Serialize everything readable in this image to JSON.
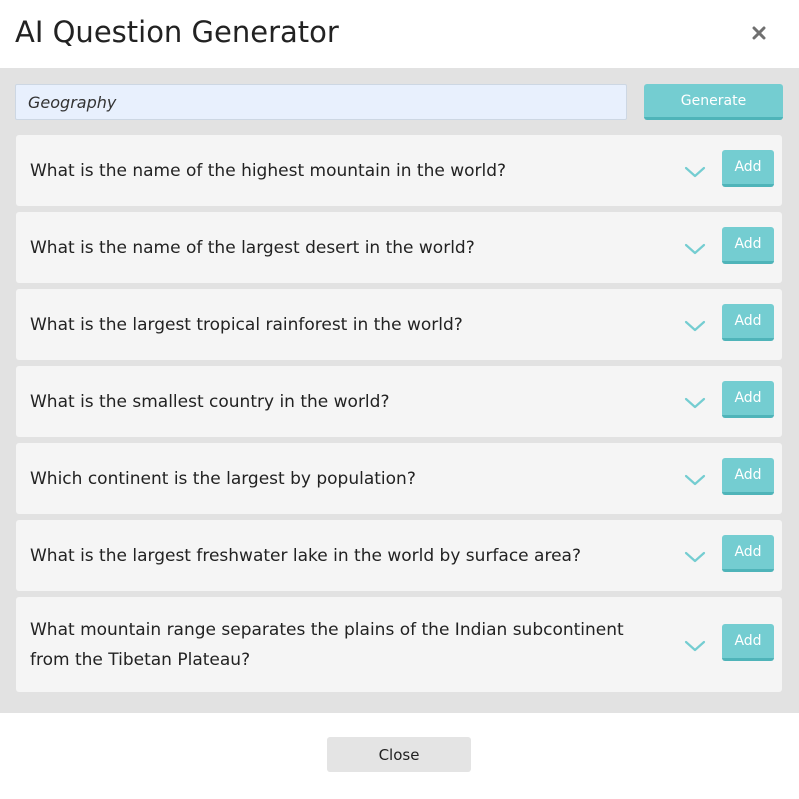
{
  "dialog": {
    "title": "AI Question Generator"
  },
  "search": {
    "value": "Geography",
    "generate_label": "Generate"
  },
  "questions": [
    {
      "text": "What is the name of the highest mountain in the world?",
      "add_label": "Add"
    },
    {
      "text": "What is the name of the largest desert in the world?",
      "add_label": "Add"
    },
    {
      "text": "What is the largest tropical rainforest in the world?",
      "add_label": "Add"
    },
    {
      "text": "What is the smallest country in the world?",
      "add_label": "Add"
    },
    {
      "text": "Which continent is the largest by population?",
      "add_label": "Add"
    },
    {
      "text": "What is the largest freshwater lake in the world by surface area?",
      "add_label": "Add"
    },
    {
      "text": "What mountain range separates the plains of the Indian subcontinent from the Tibetan Plateau?",
      "add_label": "Add"
    }
  ],
  "footer": {
    "close_label": "Close"
  },
  "icons": {
    "close": "close-icon",
    "expand": "chevron-down-icon"
  },
  "colors": {
    "accent": "#74cdd1",
    "accent_shadow": "#4fb4b9",
    "input_bg": "#e8f0fd",
    "panel_bg": "#e2e2e2",
    "card_bg": "#f5f5f5"
  }
}
